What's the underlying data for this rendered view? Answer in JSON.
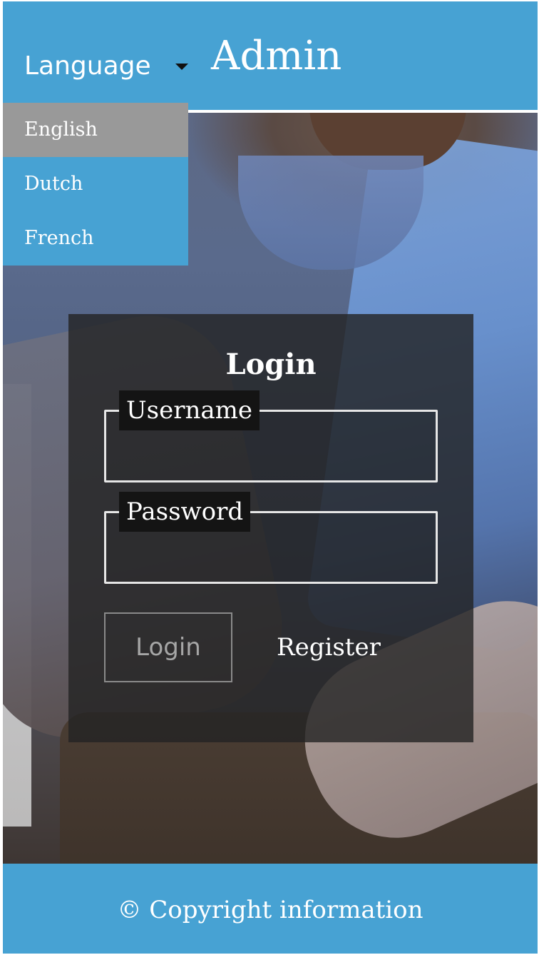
{
  "header": {
    "language_label": "Language",
    "caret_icon": "caret-down-icon",
    "title": "Admin"
  },
  "language_menu": {
    "options": [
      {
        "label": "English",
        "selected": true
      },
      {
        "label": "Dutch",
        "selected": false
      },
      {
        "label": "French",
        "selected": false
      }
    ]
  },
  "login": {
    "title": "Login",
    "username": {
      "label": "Username",
      "value": ""
    },
    "password": {
      "label": "Password",
      "value": ""
    },
    "login_button": "Login",
    "register_link": "Register"
  },
  "footer": {
    "text": "© Copyright information"
  },
  "colors": {
    "brand_blue": "#47a2d3",
    "selected_option": "#999999",
    "panel_background": "rgba(35,35,35,0.80)"
  }
}
